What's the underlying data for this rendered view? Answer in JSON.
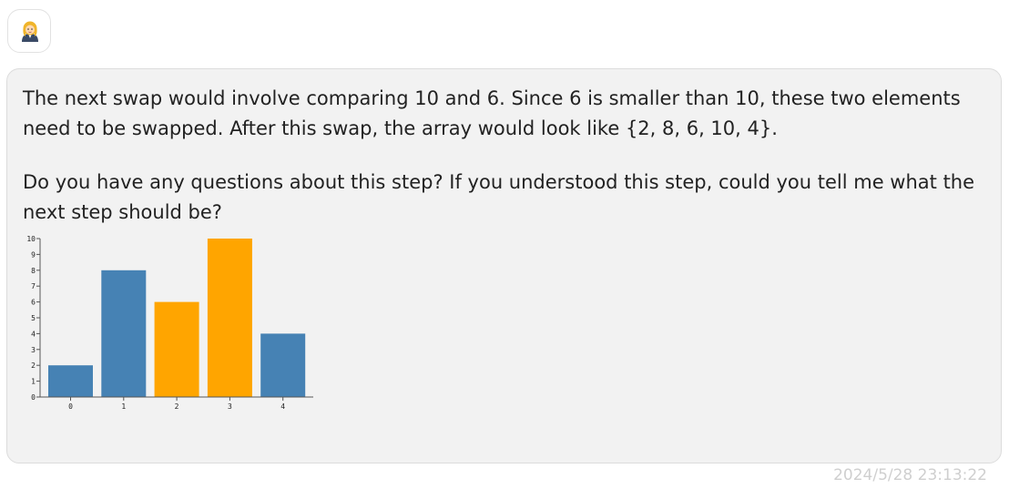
{
  "assistant": {
    "avatar_icon": "person-avatar-icon"
  },
  "message": {
    "paragraphs": [
      [
        "The next swap would involve comparing 10 and 6. Since 6 is smaller than 10, these two elements",
        "need to be swapped. After this swap, the array would look like {2, 8, 6, 10, 4}."
      ],
      [
        "Do you have any questions about this step? If you understood this step, could you tell me what the",
        "next step should be?"
      ]
    ],
    "timestamp": "2024/5/28 23:13:22"
  },
  "chart_data": {
    "type": "bar",
    "categories": [
      "0",
      "1",
      "2",
      "3",
      "4"
    ],
    "values": [
      2,
      8,
      6,
      10,
      4
    ],
    "highlighted": [
      2,
      3
    ],
    "colors": {
      "default": "#4682b4",
      "highlight": "#ffa500"
    },
    "ylim": [
      0,
      10
    ],
    "yticks": [
      0,
      1,
      2,
      3,
      4,
      5,
      6,
      7,
      8,
      9,
      10
    ],
    "grid": false
  }
}
